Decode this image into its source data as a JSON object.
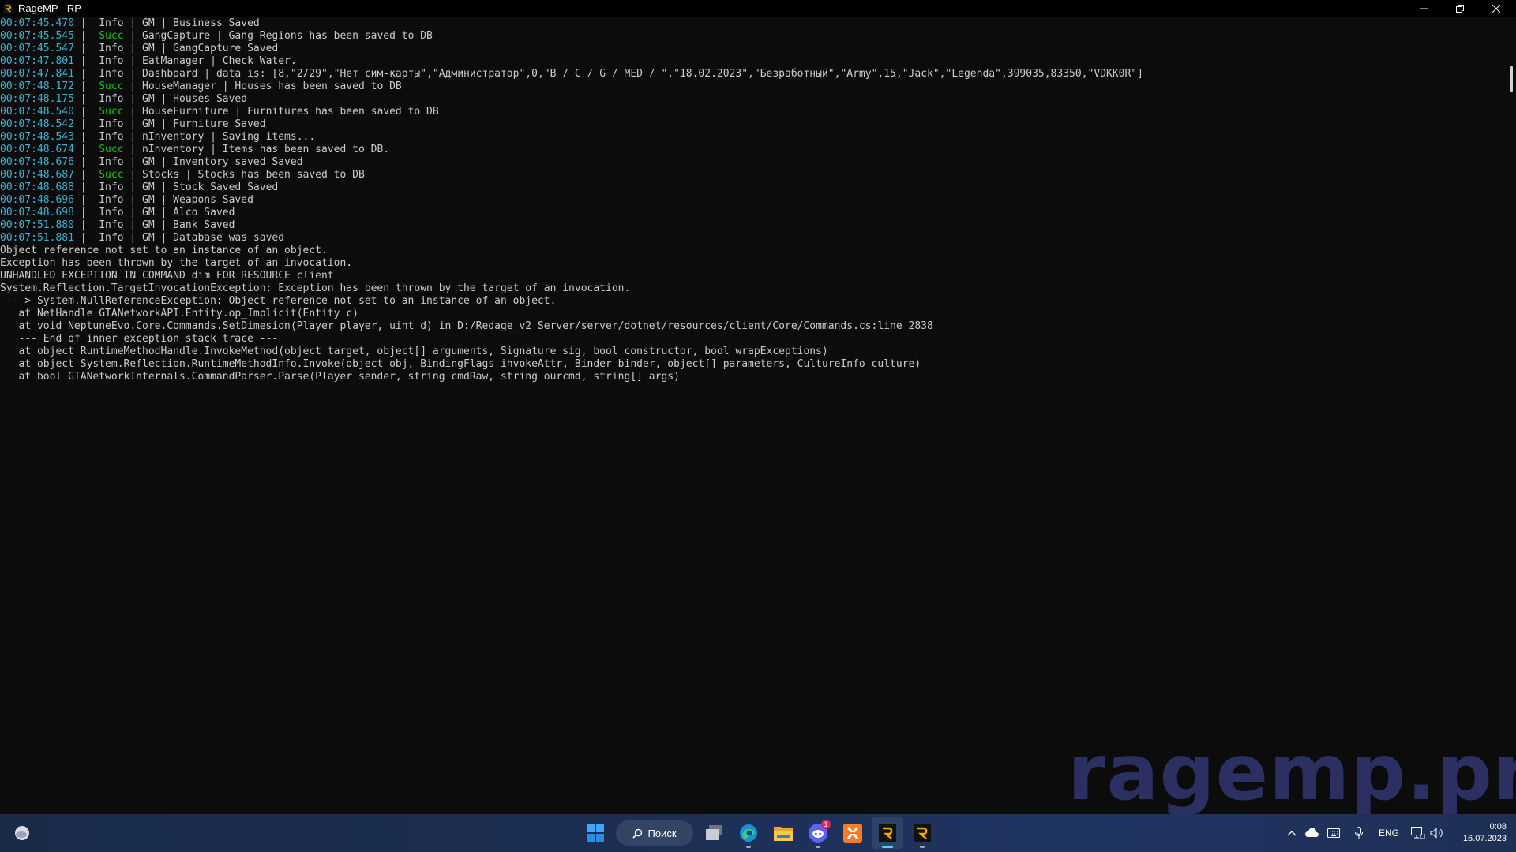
{
  "window": {
    "title": "RageMP - RP",
    "controls": [
      "minimize",
      "restore",
      "close"
    ]
  },
  "console": {
    "log": [
      {
        "ts": "00:07:45.470",
        "level": "Info",
        "msg": "GM | Business Saved"
      },
      {
        "ts": "00:07:45.545",
        "level": "Succ",
        "msg": "GangCapture | Gang Regions has been saved to DB"
      },
      {
        "ts": "00:07:45.547",
        "level": "Info",
        "msg": "GM | GangCapture Saved"
      },
      {
        "ts": "00:07:47.801",
        "level": "Info",
        "msg": "EatManager | Check Water."
      },
      {
        "ts": "00:07:47.841",
        "level": "Info",
        "msg": "Dashboard | data is: [8,\"2/29\",\"Нет сим-карты\",\"Администратор\",0,\"B / C / G / MED / \",\"18.02.2023\",\"Безработный\",\"Army\",15,\"Jack\",\"Legenda\",399035,83350,\"VDKK0R\"]"
      },
      {
        "ts": "00:07:48.172",
        "level": "Succ",
        "msg": "HouseManager | Houses has been saved to DB"
      },
      {
        "ts": "00:07:48.175",
        "level": "Info",
        "msg": "GM | Houses Saved"
      },
      {
        "ts": "00:07:48.540",
        "level": "Succ",
        "msg": "HouseFurniture | Furnitures has been saved to DB"
      },
      {
        "ts": "00:07:48.542",
        "level": "Info",
        "msg": "GM | Furniture Saved"
      },
      {
        "ts": "00:07:48.543",
        "level": "Info",
        "msg": "nInventory | Saving items..."
      },
      {
        "ts": "00:07:48.674",
        "level": "Succ",
        "msg": "nInventory | Items has been saved to DB."
      },
      {
        "ts": "00:07:48.676",
        "level": "Info",
        "msg": "GM | Inventory saved Saved"
      },
      {
        "ts": "00:07:48.687",
        "level": "Succ",
        "msg": "Stocks | Stocks has been saved to DB"
      },
      {
        "ts": "00:07:48.688",
        "level": "Info",
        "msg": "GM | Stock Saved Saved"
      },
      {
        "ts": "00:07:48.696",
        "level": "Info",
        "msg": "GM | Weapons Saved"
      },
      {
        "ts": "00:07:48.698",
        "level": "Info",
        "msg": "GM | Alco Saved"
      },
      {
        "ts": "00:07:51.880",
        "level": "Info",
        "msg": "GM | Bank Saved"
      },
      {
        "ts": "00:07:51.881",
        "level": "Info",
        "msg": "GM | Database was saved"
      }
    ],
    "plain": [
      "Object reference not set to an instance of an object.",
      "Exception has been thrown by the target of an invocation.",
      "UNHANDLED EXCEPTION IN COMMAND dim FOR RESOURCE client",
      "System.Reflection.TargetInvocationException: Exception has been thrown by the target of an invocation.",
      " ---> System.NullReferenceException: Object reference not set to an instance of an object.",
      "   at NetHandle GTANetworkAPI.Entity.op_Implicit(Entity c)",
      "   at void NeptuneEvo.Core.Commands.SetDimesion(Player player, uint d) in D:/Redage_v2 Server/server/dotnet/resources/client/Core/Commands.cs:line 2838",
      "   --- End of inner exception stack trace ---",
      "   at object RuntimeMethodHandle.InvokeMethod(object target, object[] arguments, Signature sig, bool constructor, bool wrapExceptions)",
      "   at object System.Reflection.RuntimeMethodInfo.Invoke(object obj, BindingFlags invokeAttr, Binder binder, object[] parameters, CultureInfo culture)",
      "   at bool GTANetworkInternals.CommandParser.Parse(Player sender, string cmdRaw, string ourcmd, string[] args)"
    ]
  },
  "watermark": "ragemp.pro",
  "taskbar": {
    "search_label": "Поиск",
    "apps": [
      {
        "name": "start-icon"
      },
      {
        "name": "task-view-icon"
      },
      {
        "name": "edge-icon"
      },
      {
        "name": "file-explorer-icon"
      },
      {
        "name": "discord-icon",
        "badge": "1"
      },
      {
        "name": "xampp-icon"
      },
      {
        "name": "ragemp-icon",
        "active": true
      },
      {
        "name": "ragemp-icon"
      }
    ],
    "tray": {
      "language": "ENG",
      "time": "0:08",
      "date": "16.07.2023"
    }
  },
  "colors": {
    "timestamp": "#3ab4d6",
    "succ": "#16c60c",
    "text": "#cccccc",
    "background": "#0c0c0c",
    "watermark": "#2b2f62"
  }
}
